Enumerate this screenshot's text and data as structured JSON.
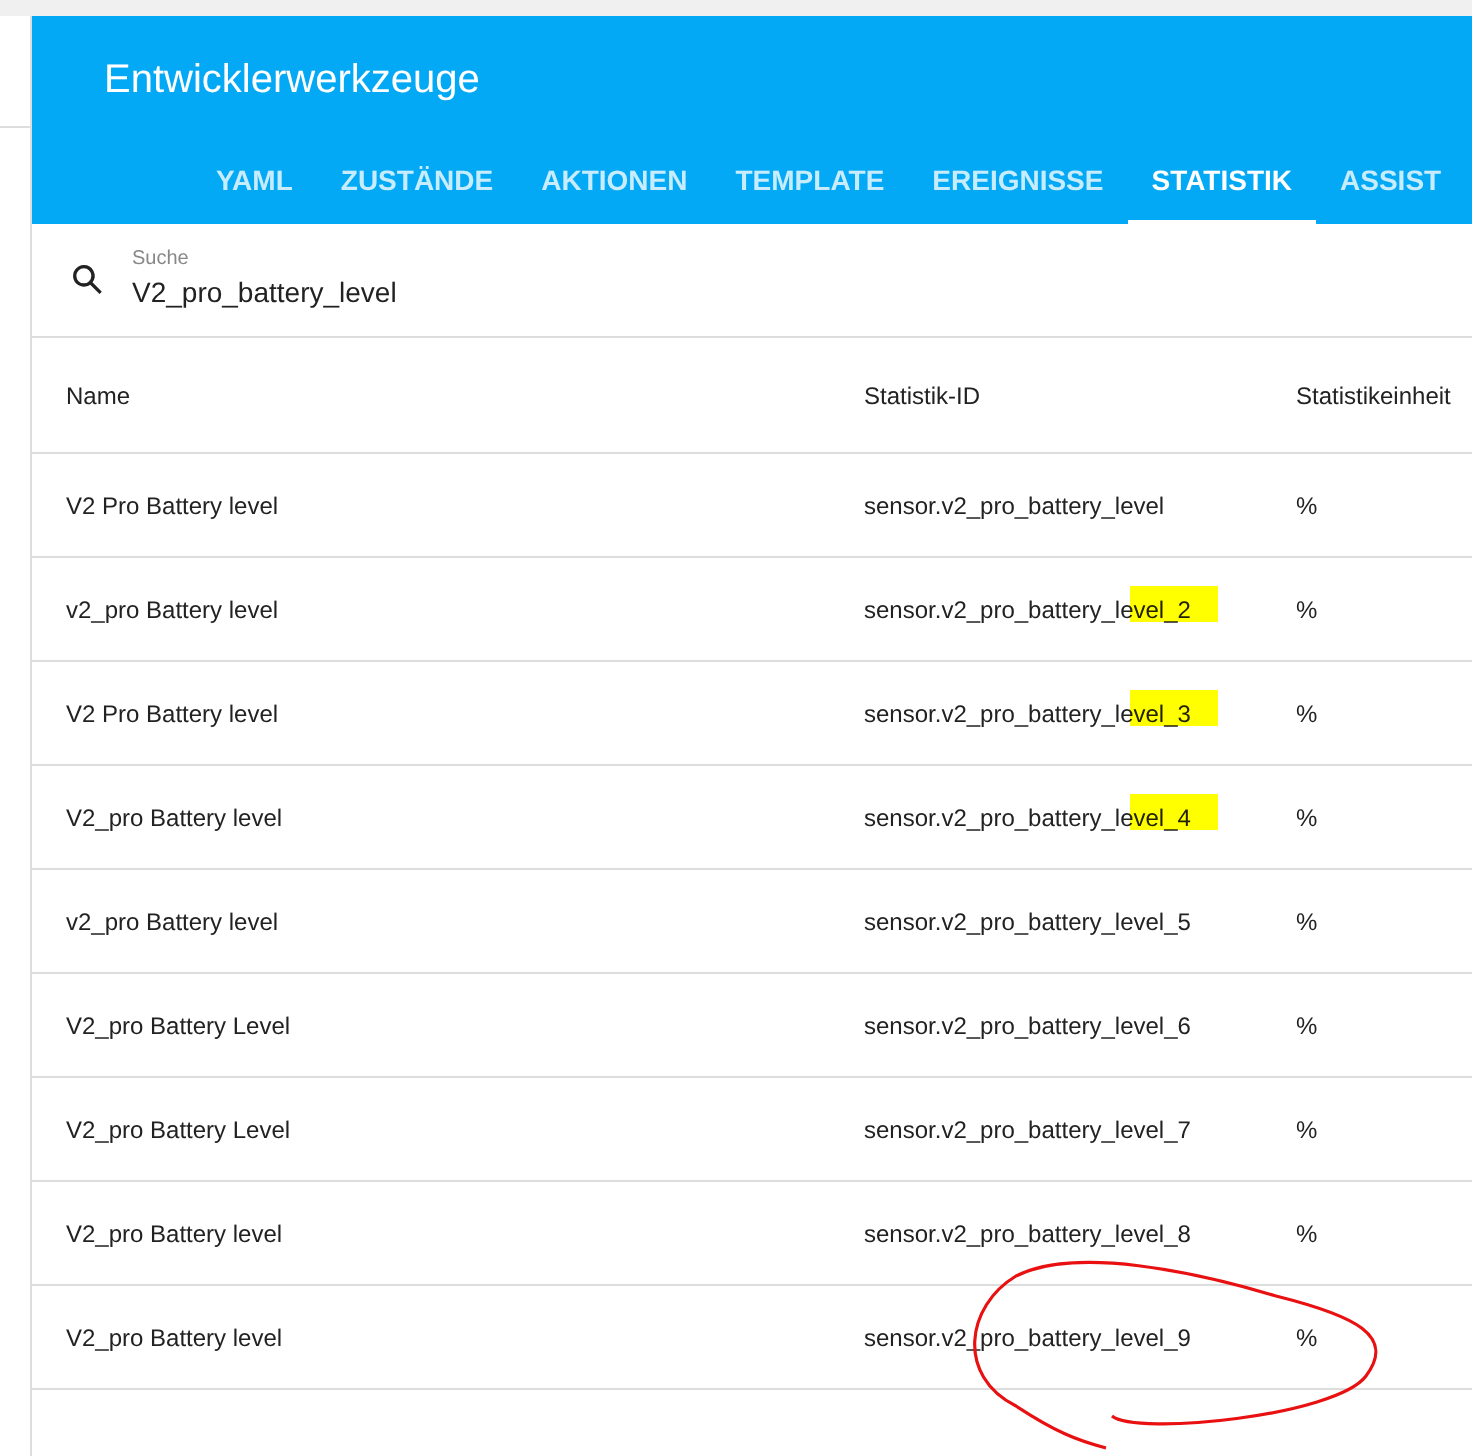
{
  "header": {
    "title": "Entwicklerwerkzeuge"
  },
  "tabs": [
    {
      "label": "YAML",
      "selected": false
    },
    {
      "label": "ZUSTÄNDE",
      "selected": false
    },
    {
      "label": "AKTIONEN",
      "selected": false
    },
    {
      "label": "TEMPLATE",
      "selected": false
    },
    {
      "label": "EREIGNISSE",
      "selected": false
    },
    {
      "label": "STATISTIK",
      "selected": true
    },
    {
      "label": "ASSIST",
      "selected": false
    }
  ],
  "search": {
    "label": "Suche",
    "value": "V2_pro_battery_level"
  },
  "table": {
    "columns": [
      "Name",
      "Statistik-ID",
      "Statistikeinheit"
    ],
    "rows": [
      {
        "name": "V2 Pro Battery level",
        "id": "sensor.v2_pro_battery_level",
        "unit": "%",
        "highlighted": false,
        "circled": false
      },
      {
        "name": "v2_pro Battery level",
        "id": "sensor.v2_pro_battery_level_2",
        "unit": "%",
        "highlighted": true,
        "circled": false
      },
      {
        "name": "V2 Pro Battery level",
        "id": "sensor.v2_pro_battery_level_3",
        "unit": "%",
        "highlighted": true,
        "circled": false
      },
      {
        "name": "V2_pro Battery level",
        "id": "sensor.v2_pro_battery_level_4",
        "unit": "%",
        "highlighted": true,
        "circled": false
      },
      {
        "name": "v2_pro Battery level",
        "id": "sensor.v2_pro_battery_level_5",
        "unit": "%",
        "highlighted": false,
        "circled": false
      },
      {
        "name": "V2_pro Battery Level",
        "id": "sensor.v2_pro_battery_level_6",
        "unit": "%",
        "highlighted": false,
        "circled": false
      },
      {
        "name": "V2_pro Battery Level",
        "id": "sensor.v2_pro_battery_level_7",
        "unit": "%",
        "highlighted": false,
        "circled": false
      },
      {
        "name": "V2_pro Battery level",
        "id": "sensor.v2_pro_battery_level_8",
        "unit": "%",
        "highlighted": false,
        "circled": false
      },
      {
        "name": "V2_pro Battery level",
        "id": "sensor.v2_pro_battery_level_9",
        "unit": "%",
        "highlighted": false,
        "circled": true
      }
    ]
  }
}
